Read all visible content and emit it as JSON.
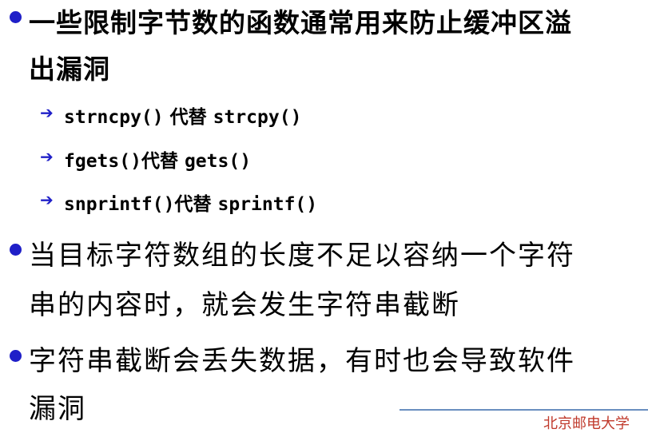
{
  "bullets": [
    {
      "lines": [
        "一些限制字节数的函数通常用来防止缓冲区溢",
        "出漏洞"
      ]
    },
    {
      "lines": [
        "当目标字符数组的长度不足以容纳一个字符",
        "串的内容时，就会发生字符串截断"
      ]
    },
    {
      "lines": [
        "字符串截断会丢失数据，有时也会导致软件",
        "漏洞"
      ]
    }
  ],
  "sub_items": [
    {
      "new_func": "strncpy()",
      "joiner": " 代替 ",
      "old_func": "strcpy()"
    },
    {
      "new_func": "fgets()",
      "joiner": "代替 ",
      "old_func": "gets()"
    },
    {
      "new_func": "snprintf()",
      "joiner": "代替 ",
      "old_func": "sprintf()"
    }
  ],
  "footer": {
    "text": "北京邮电大学"
  },
  "colors": {
    "bullet": "#1f1fc8",
    "arrow": "#1f1fc8",
    "footer_text": "#c0392b",
    "footer_rule": "#6a8fc0"
  }
}
